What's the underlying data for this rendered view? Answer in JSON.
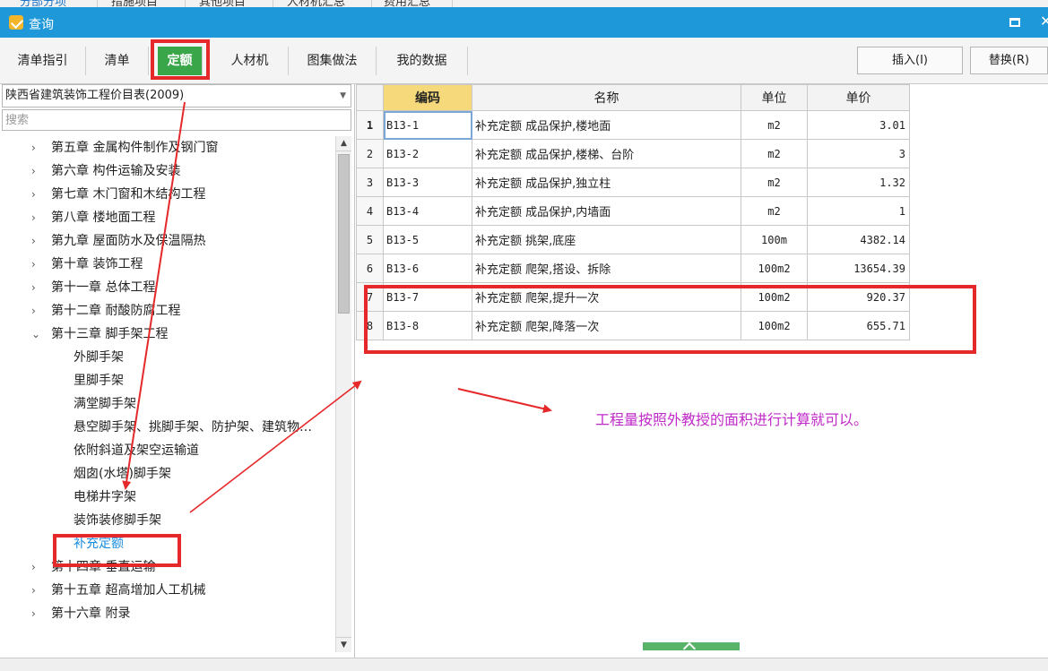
{
  "top_tabs": [
    {
      "label": "分部分项"
    },
    {
      "label": "措施项目"
    },
    {
      "label": "其他项目"
    },
    {
      "label": "人材机汇总"
    },
    {
      "label": "费用汇总"
    }
  ],
  "window": {
    "title": "查询"
  },
  "tabs": [
    {
      "label": "清单指引"
    },
    {
      "label": "清单"
    },
    {
      "label": "定额"
    },
    {
      "label": "人材机"
    },
    {
      "label": "图集做法"
    },
    {
      "label": "我的数据"
    }
  ],
  "actions": {
    "insert": "插入(I)",
    "replace": "替换(R)"
  },
  "library": {
    "selected": "陕西省建筑装饰工程价目表(2009)"
  },
  "search": {
    "placeholder": "搜索"
  },
  "tree": [
    {
      "label": "第五章 金属构件制作及钢门窗"
    },
    {
      "label": "第六章 构件运输及安装"
    },
    {
      "label": "第七章 木门窗和木结构工程"
    },
    {
      "label": "第八章 楼地面工程"
    },
    {
      "label": "第九章 屋面防水及保温隔热"
    },
    {
      "label": "第十章 装饰工程"
    },
    {
      "label": "第十一章 总体工程"
    },
    {
      "label": "第十二章 耐酸防腐工程"
    },
    {
      "label": "第十三章 脚手架工程"
    },
    {
      "label": "外脚手架"
    },
    {
      "label": "里脚手架"
    },
    {
      "label": "满堂脚手架"
    },
    {
      "label": "悬空脚手架、挑脚手架、防护架、建筑物…"
    },
    {
      "label": "依附斜道及架空运输道"
    },
    {
      "label": "烟囱(水塔)脚手架"
    },
    {
      "label": "电梯井字架"
    },
    {
      "label": "装饰装修脚手架"
    },
    {
      "label": "补充定额"
    },
    {
      "label": "第十四章 垂直运输"
    },
    {
      "label": "第十五章 超高增加人工机械"
    },
    {
      "label": "第十六章 附录"
    }
  ],
  "table": {
    "headers": {
      "code": "编码",
      "name": "名称",
      "unit": "单位",
      "price": "单价"
    },
    "rows": [
      {
        "num": "1",
        "code": "B13-1",
        "name": "补充定额 成品保护,楼地面",
        "unit": "m2",
        "price": "3.01"
      },
      {
        "num": "2",
        "code": "B13-2",
        "name": "补充定额 成品保护,楼梯、台阶",
        "unit": "m2",
        "price": "3"
      },
      {
        "num": "3",
        "code": "B13-3",
        "name": "补充定额 成品保护,独立柱",
        "unit": "m2",
        "price": "1.32"
      },
      {
        "num": "4",
        "code": "B13-4",
        "name": "补充定额 成品保护,内墙面",
        "unit": "m2",
        "price": "1"
      },
      {
        "num": "5",
        "code": "B13-5",
        "name": "补充定额 挑架,底座",
        "unit": "100m",
        "price": "4382.14"
      },
      {
        "num": "6",
        "code": "B13-6",
        "name": "补充定额 爬架,搭设、拆除",
        "unit": "100m2",
        "price": "13654.39"
      },
      {
        "num": "7",
        "code": "B13-7",
        "name": "补充定额 爬架,提升一次",
        "unit": "100m2",
        "price": "920.37"
      },
      {
        "num": "8",
        "code": "B13-8",
        "name": "补充定额 爬架,降落一次",
        "unit": "100m2",
        "price": "655.71"
      }
    ]
  },
  "annotation": {
    "text": "工程量按照外教授的面积进行计算就可以。"
  },
  "colors": {
    "titlebar": "#1e98d8",
    "active_tab": "#3aa64a",
    "highlight": "#e5282a",
    "annotation": "#c02ac8"
  }
}
